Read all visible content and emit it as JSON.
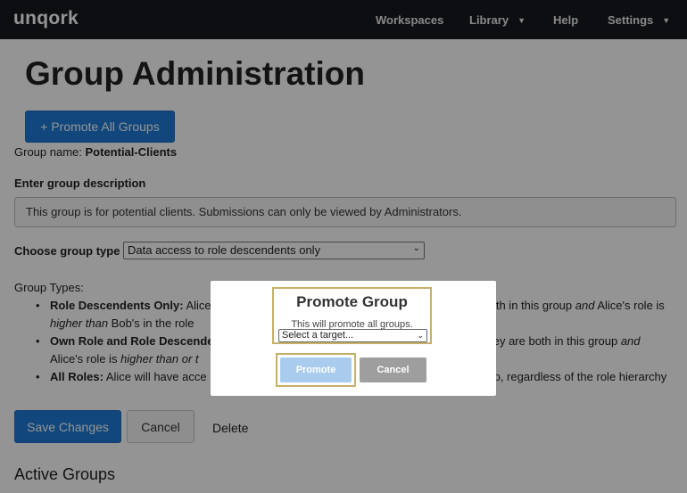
{
  "navbar": {
    "brand": "unqork",
    "items": [
      {
        "label": "Workspaces"
      },
      {
        "label": "Library"
      },
      {
        "label": "Help"
      },
      {
        "label": "Settings"
      }
    ]
  },
  "page": {
    "title": "Group Administration",
    "promote_all_label": "+ Promote All Groups",
    "group_name_label": "Group name: ",
    "group_name_value": "Potential-Clients",
    "description_label": "Enter group description",
    "description_value": "This group is for potential clients. Submissions can only be viewed by Administrators.",
    "group_type_label": "Choose group type",
    "group_type_value": "Data access to role descendents only",
    "group_types_heading": "Group Types:",
    "group_types": [
      {
        "name": "Role Descendents Only:",
        "pre": " Alice",
        "mid": "oth in this group ",
        "em1": "and",
        "mid2": " Alice's role is ",
        "em2": "higher than",
        "post": " Bob's in the role"
      },
      {
        "name": "Own Role and Role Descende",
        "mid": "hey are both in this group ",
        "em1": "and",
        "mid2": " Alice's role is ",
        "em2": "higher than or t"
      },
      {
        "name": "All Roles:",
        "pre": " Alice will have acce",
        "post": "p, regardless of the role hierarchy"
      }
    ],
    "save_label": "Save Changes",
    "cancel_label": "Cancel",
    "delete_label": "Delete",
    "active_groups_heading": "Active Groups"
  },
  "modal": {
    "title": "Promote Group",
    "text": "This will promote all groups.",
    "select_placeholder": "Select a target...",
    "promote_label": "Promote",
    "cancel_label": "Cancel"
  },
  "colors": {
    "navbar": "#16191f",
    "primary": "#1e7ad8",
    "highlight_border": "#c7b06b"
  }
}
